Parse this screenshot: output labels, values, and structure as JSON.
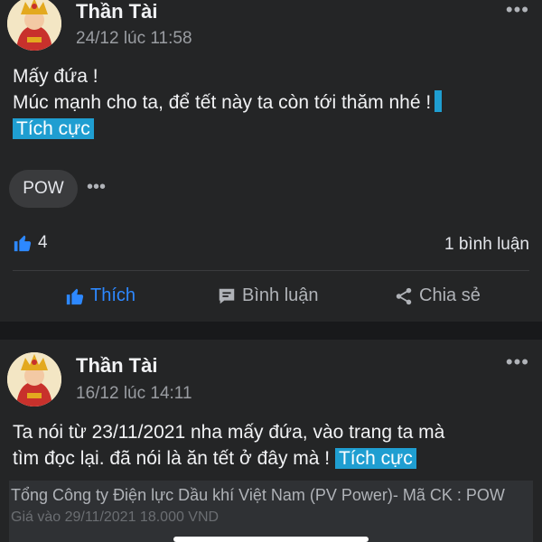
{
  "posts": [
    {
      "author": "Thần Tài",
      "time": "24/12 lúc 11:58",
      "text_line1": "Mấy đứa !",
      "text_line2": "Múc mạnh cho ta, để tết này ta còn tới thăm nhé !",
      "tag": "Tích cực",
      "ticker": "POW",
      "likes": "4",
      "comments": "1 bình luận",
      "actions": {
        "like": "Thích",
        "comment": "Bình luận",
        "share": "Chia sẻ"
      }
    },
    {
      "author": "Thần Tài",
      "time": "16/12 lúc 14:11",
      "text_line1": "Ta nói từ 23/11/2021 nha mấy đứa, vào trang ta mà",
      "text_line2": "tìm đọc lại. đã nói là ăn tết ở đây mà !",
      "tag": "Tích cực",
      "preview_line1": "Tổng Công ty Điện lực Dầu khí Việt Nam (PV Power)- Mã CK : POW",
      "preview_line2": "Giá    vào   29/11/2021    18.000 VND"
    }
  ],
  "colors": {
    "background": "#18191b",
    "card": "#242526",
    "accent": "#2d88ff",
    "tag": "#1f9ed1"
  },
  "icons": [
    "more-icon",
    "like-icon",
    "comment-icon",
    "share-icon",
    "avatar-image"
  ]
}
